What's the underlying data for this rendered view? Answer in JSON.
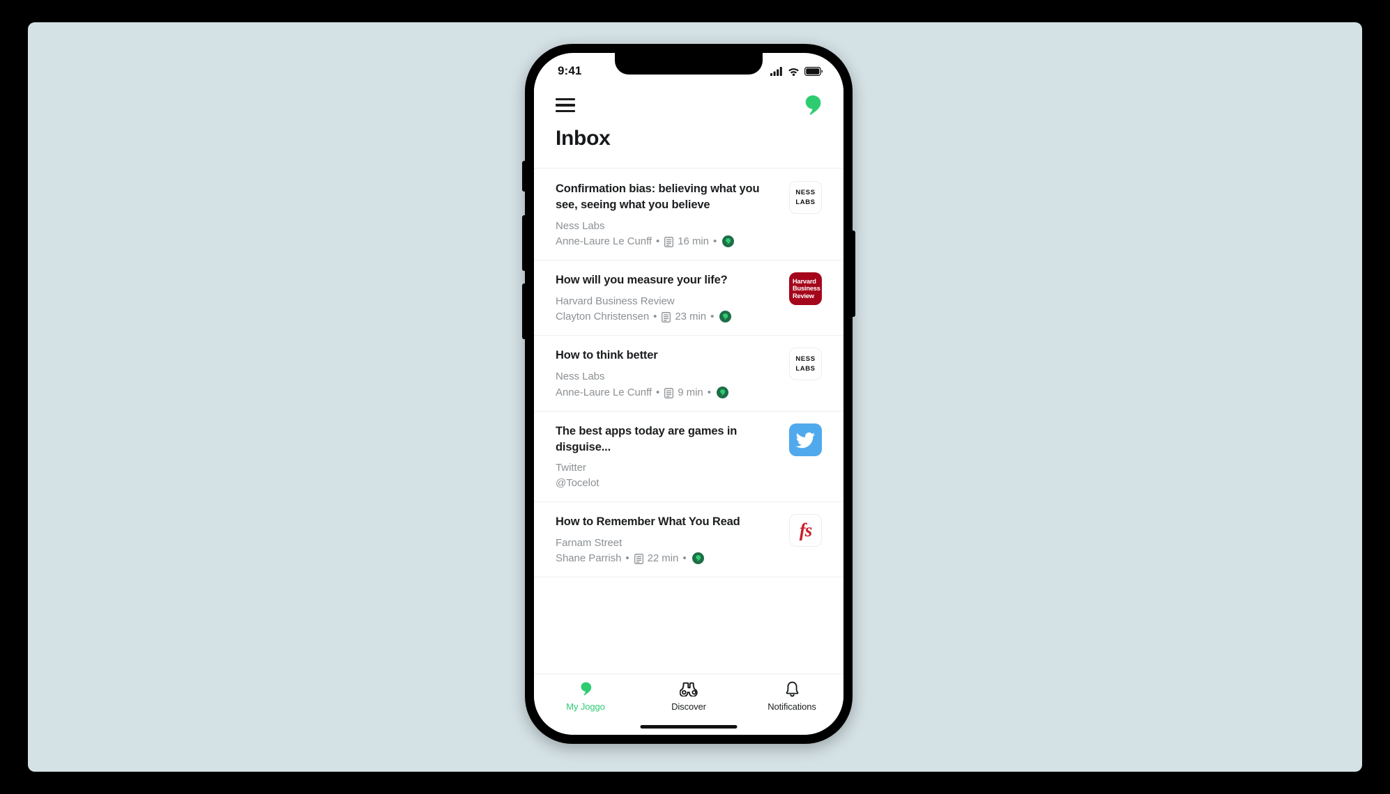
{
  "theme": {
    "canvas_bg": "#d4e1e5",
    "outer_bg": "#000000",
    "brand_green": "#2ecc71",
    "badge_circle": "#1e6e48",
    "badge_comma": "#2ecc71",
    "text_primary": "#1b1d1f",
    "text_muted": "#8c9094"
  },
  "status_bar": {
    "time": "9:41",
    "icons": [
      "cellular-signal-icon",
      "wifi-icon",
      "battery-icon"
    ]
  },
  "header": {
    "menu_icon": "hamburger-menu-icon",
    "logo_icon": "joggo-comma-logo-icon"
  },
  "page": {
    "title": "Inbox"
  },
  "list": {
    "items": [
      {
        "title": "Confirmation bias: believing what you see, seeing what you believe",
        "source": "Ness Labs",
        "author": "Anne-Laure Le Cunff",
        "sep1": "•",
        "doc_icon": "article-document-icon",
        "read_time": "16 min",
        "sep2": "•",
        "badge_icon": "joggo-read-badge-icon",
        "thumb_kind": "ness",
        "thumb_line1": "NESS",
        "thumb_line2": "LABS",
        "has_meta": true
      },
      {
        "title": "How will you measure your life?",
        "source": "Harvard Business Review",
        "author": "Clayton Christensen",
        "sep1": "•",
        "doc_icon": "article-document-icon",
        "read_time": "23 min",
        "sep2": "•",
        "badge_icon": "joggo-read-badge-icon",
        "thumb_kind": "hbr",
        "thumb_line1": "Harvard",
        "thumb_line2": "Business",
        "thumb_line3": "Review",
        "has_meta": true
      },
      {
        "title": "How to think better",
        "source": "Ness Labs",
        "author": "Anne-Laure Le Cunff",
        "sep1": "•",
        "doc_icon": "article-document-icon",
        "read_time": "9 min",
        "sep2": "•",
        "badge_icon": "joggo-read-badge-icon",
        "thumb_kind": "ness",
        "thumb_line1": "NESS",
        "thumb_line2": "LABS",
        "has_meta": true
      },
      {
        "title": "The best apps today are games in disguise...",
        "source": "Twitter",
        "author": "@Tocelot",
        "thumb_kind": "twitter",
        "thumb_icon": "twitter-bird-icon",
        "has_meta": false
      },
      {
        "title": "How to Remember What You Read",
        "source": "Farnam Street",
        "author": "Shane Parrish",
        "sep1": "•",
        "doc_icon": "article-document-icon",
        "read_time": "22 min",
        "sep2": "•",
        "badge_icon": "joggo-read-badge-icon",
        "thumb_kind": "fs",
        "thumb_line1": "fs",
        "has_meta": true
      }
    ]
  },
  "tabbar": {
    "tabs": [
      {
        "label": "My Joggo",
        "icon": "joggo-comma-icon",
        "active": true
      },
      {
        "label": "Discover",
        "icon": "binoculars-icon",
        "active": false
      },
      {
        "label": "Notifications",
        "icon": "bell-icon",
        "active": false
      }
    ]
  }
}
